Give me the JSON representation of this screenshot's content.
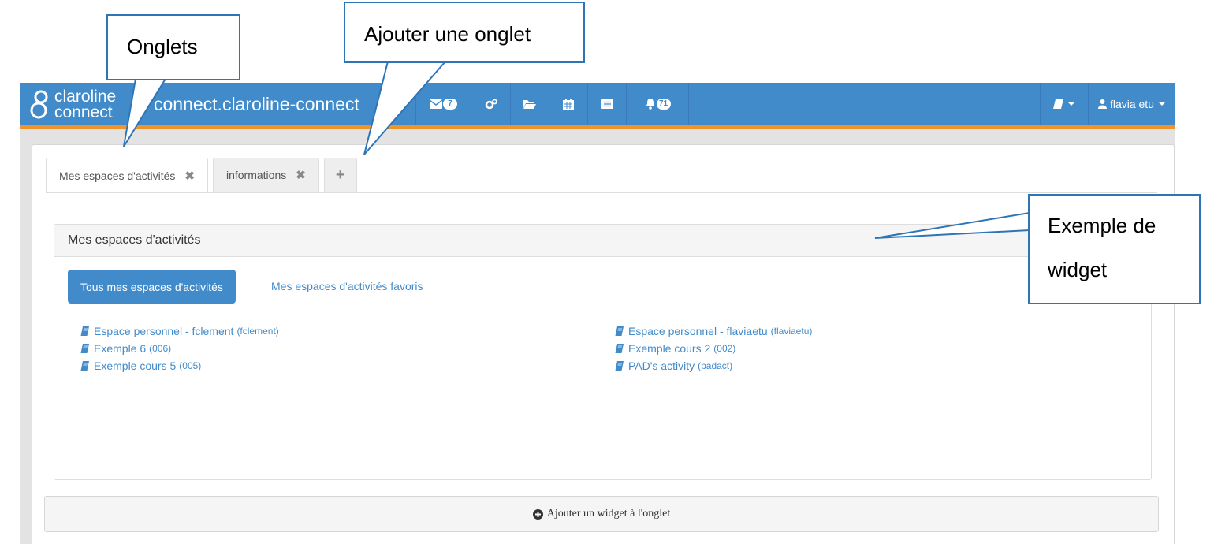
{
  "navbar": {
    "logo_line1": "claroline",
    "logo_line2": "connect",
    "site_title": "connect.claroline-connect",
    "items": [
      {
        "icon": "envelope-icon",
        "badge": "7"
      },
      {
        "icon": "gears-icon",
        "badge": ""
      },
      {
        "icon": "folder-open-icon",
        "badge": ""
      },
      {
        "icon": "calendar-icon",
        "badge": ""
      },
      {
        "icon": "list-icon",
        "badge": ""
      },
      {
        "icon": "bell-icon",
        "badge": "71"
      }
    ],
    "right": {
      "book_menu_icon": "book-icon",
      "user_label": "flavia etu",
      "user_icon": "user-icon"
    },
    "colors": {
      "navbar": "#428bca",
      "accent": "#f0932b"
    }
  },
  "tabs": [
    {
      "label": "Mes espaces d'activités",
      "active": true
    },
    {
      "label": "informations",
      "active": false
    }
  ],
  "tab_add_label": "+",
  "tab_close_glyph": "✖",
  "widget": {
    "title": "Mes espaces d'activités",
    "primary_button": "Tous mes espaces d'activités",
    "favorites_link": "Mes espaces d'activités favoris",
    "left_column": [
      {
        "name": "Espace personnel - fclement",
        "code": "(fclement)"
      },
      {
        "name": "Exemple 6",
        "code": "(006)"
      },
      {
        "name": "Exemple cours 5",
        "code": "(005)"
      }
    ],
    "right_column": [
      {
        "name": "Espace personnel - flaviaetu",
        "code": "(flaviaetu)"
      },
      {
        "name": "Exemple cours 2",
        "code": "(002)"
      },
      {
        "name": "PAD's activity",
        "code": "(padact)"
      }
    ]
  },
  "add_widget_label": "Ajouter un widget à l'onglet",
  "callouts": {
    "tabs": "Onglets",
    "add_tab": "Ajouter une onglet",
    "widget_line1": "Exemple de",
    "widget_line2": "widget"
  }
}
